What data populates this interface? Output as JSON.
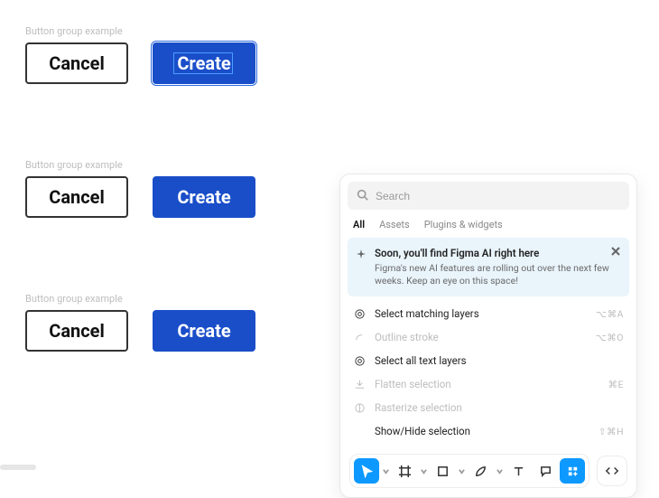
{
  "groups": [
    {
      "label": "Button group example",
      "cancel": "Cancel",
      "create": "Create",
      "selected": true
    },
    {
      "label": "Button group example",
      "cancel": "Cancel",
      "create": "Create",
      "selected": false
    },
    {
      "label": "Button group example",
      "cancel": "Cancel",
      "create": "Create",
      "selected": false
    }
  ],
  "panel": {
    "search_placeholder": "Search",
    "tabs": {
      "all": "All",
      "assets": "Assets",
      "plugins": "Plugins & widgets"
    },
    "notice": {
      "title": "Soon, you'll find Figma AI right here",
      "body": "Figma's new AI features are rolling out over the next few weeks. Keep an eye on this space!"
    },
    "actions": [
      {
        "id": "select-matching",
        "label": "Select matching layers",
        "shortcut": "⌥⌘A",
        "enabled": true,
        "icon": "target"
      },
      {
        "id": "outline-stroke",
        "label": "Outline stroke",
        "shortcut": "⌥⌘O",
        "enabled": false,
        "icon": "outline"
      },
      {
        "id": "select-text",
        "label": "Select all text layers",
        "shortcut": "",
        "enabled": true,
        "icon": "target"
      },
      {
        "id": "flatten",
        "label": "Flatten selection",
        "shortcut": "⌘E",
        "enabled": false,
        "icon": "flatten"
      },
      {
        "id": "rasterize",
        "label": "Rasterize selection",
        "shortcut": "",
        "enabled": false,
        "icon": "rasterize"
      },
      {
        "id": "show-hide",
        "label": "Show/Hide selection",
        "shortcut": "⇧⌘H",
        "enabled": true,
        "icon": ""
      }
    ]
  },
  "toolbar": {
    "tools": [
      "move",
      "frame",
      "shape",
      "pen",
      "text",
      "comment",
      "ai"
    ],
    "dev": "dev-mode"
  }
}
